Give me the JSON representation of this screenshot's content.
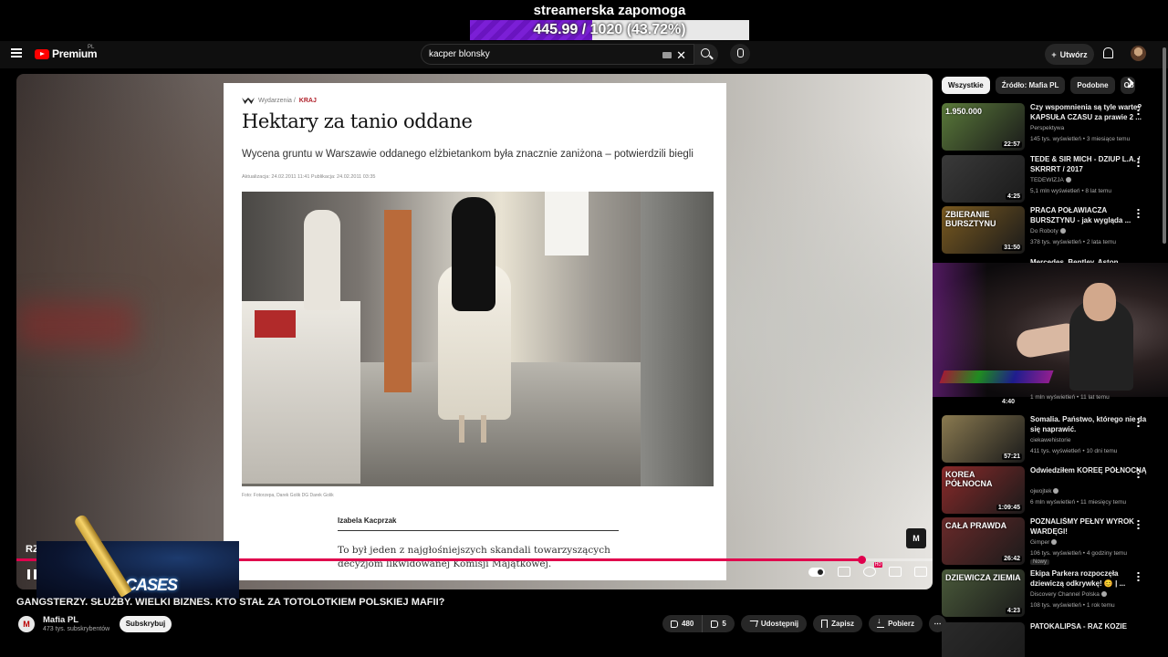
{
  "donation": {
    "title": "streamerska zapomoga",
    "progress_text": "445.99 / 1020 (43.72%)",
    "progress_fraction": 0.4372,
    "fill_color": "#7b1fd6"
  },
  "header": {
    "brand": "Premium",
    "brand_suffix": "PL",
    "search_value": "kacper blonsky",
    "create_label": "Utwórz"
  },
  "article": {
    "breadcrumb_section": "Wydarzenia /",
    "breadcrumb_current": "KRAJ",
    "title": "Hektary za tanio oddane",
    "lead": "Wycena gruntu w Warszawie oddanego elżbietankom była znacznie zaniżona – potwierdzili biegli",
    "meta": "Aktualizacja: 24.02.2011 11:41     Publikacja: 24.02.2011 03:35",
    "photo_caption": "Foto: Fotorzepa, Darek Golik DG Darek Golik",
    "author": "Izabela Kacprzak",
    "body": "To był jeden z najgłośniejszych skandali towarzyszących decyzjom likwidowanej Komisji Majątkowej."
  },
  "player": {
    "chapter_label": "RZ",
    "channel_badge": "M",
    "progress_fraction": 0.922
  },
  "ad": {
    "text": "CASES"
  },
  "video": {
    "title": "GANGSTERZY. SŁUŻBY. WIELKI BIZNES. KTO STAŁ ZA TOTOLOTKIEM POLSKIEJ MAFII?",
    "channel": "Mafia PL",
    "channel_initial": "M",
    "subscribers": "473 tys. subskrybentów",
    "subscribe_label": "Subskrybuj",
    "likes": "480",
    "dislikes": "5",
    "share_label": "Udostępnij",
    "save_label": "Zapisz",
    "download_label": "Pobierz"
  },
  "sidebar": {
    "chips": [
      "Wszystkie",
      "Źródło: Mafia PL",
      "Podobne",
      "Ob"
    ],
    "recommendations": [
      {
        "title": "Czy wspomnienia są tyle warte? KAPSUŁA CZASU za prawie 2 ...",
        "channel": "Perspektywa",
        "verified": false,
        "meta": "145 tys. wyświetleń • 3 miesiące temu",
        "duration": "22:57",
        "thumb_color": "#5a7a3a",
        "thumb_text": "1.950.000"
      },
      {
        "title": "TEDE & SIR MICH - DZIUP L.A. / SKRRRT / 2017",
        "channel": "TEDEWIZJA",
        "verified": true,
        "meta": "5,1 mln wyświetleń • 8 lat temu",
        "duration": "4:25",
        "thumb_color": "#3a3a3a",
        "thumb_text": ""
      },
      {
        "title": "PRACA POŁAWIACZA BURSZTYNU - jak wygląda ...",
        "channel": "Do Roboty",
        "verified": true,
        "meta": "378 tys. wyświetleń • 2 lata temu",
        "duration": "31:50",
        "thumb_color": "#7a5a20",
        "thumb_text": "ZBIERANIE BURSZTYNU"
      },
      {
        "title": "Somalia. Państwo, którego nie da się naprawić.",
        "channel": "ciekawehistorie",
        "verified": false,
        "meta": "411 tys. wyświetleń • 10 dni temu",
        "duration": "57:21",
        "thumb_color": "#8a7a50",
        "thumb_text": ""
      },
      {
        "title": "Odwiedziłem KOREĘ PÓŁNOCNĄ",
        "channel": "ojwojtek",
        "verified": true,
        "meta": "6 mln wyświetleń • 11 miesięcy temu",
        "duration": "1:09:45",
        "thumb_color": "#8a2a2a",
        "thumb_text": "KOREA PÓŁNOCNA"
      },
      {
        "title": "POZNALIŚMY PEŁNY WYROK WARDĘGI!",
        "channel": "Gimper",
        "verified": true,
        "meta": "106 tys. wyświetleń • 4 godziny temu",
        "duration": "26:42",
        "thumb_color": "#6a2a2a",
        "thumb_text": "CAŁA PRAWDA",
        "badge": "Nowy"
      },
      {
        "title": "Ekipa Parkera rozpoczęła dziewiczą odkrywkę! 😊 | ...",
        "channel": "Discovery Channel Polska",
        "verified": true,
        "meta": "108 tys. wyświetleń • 1 rok temu",
        "duration": "4:23",
        "thumb_color": "#4a5a3a",
        "thumb_text": "DZIEWICZA ZIEMIA"
      },
      {
        "title": "PATOKALIPSA - RAZ KOZIE",
        "channel": "",
        "verified": false,
        "meta": "",
        "duration": "",
        "thumb_color": "#2a2a2a",
        "thumb_text": ""
      }
    ],
    "webcam_duration": "4:40",
    "webcam_meta": "1 mln wyświetleń • 11 lat temu",
    "hidden_title_fragment": "Mercedes, Bentley, Aston"
  }
}
